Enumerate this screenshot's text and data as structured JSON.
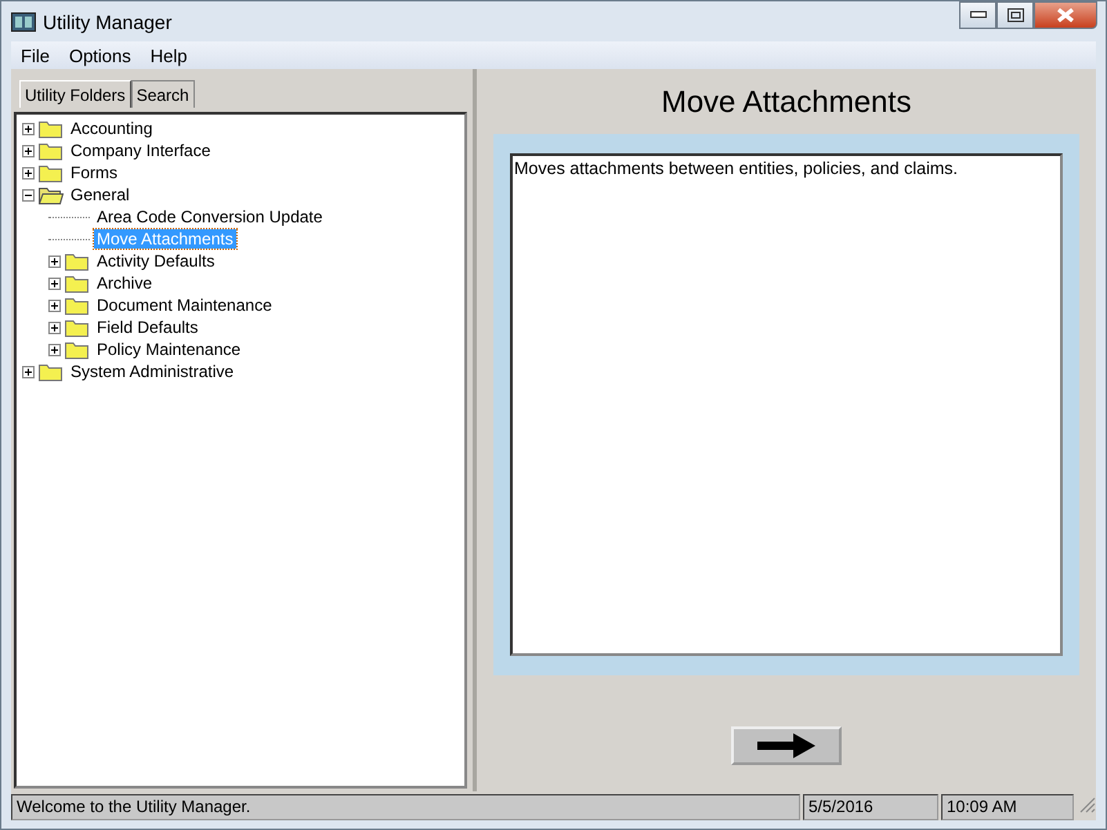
{
  "window": {
    "title": "Utility Manager"
  },
  "menu": [
    "File",
    "Options",
    "Help"
  ],
  "tabs": [
    {
      "label": "Utility Folders",
      "selected": true
    },
    {
      "label": "Search",
      "selected": false
    }
  ],
  "tree": [
    {
      "kind": "folder",
      "label": "Accounting",
      "expanded": false,
      "selected": false
    },
    {
      "kind": "folder",
      "label": "Company Interface",
      "expanded": false,
      "selected": false
    },
    {
      "kind": "folder",
      "label": "Forms",
      "expanded": false,
      "selected": false
    },
    {
      "kind": "folder",
      "label": "General",
      "expanded": true,
      "selected": false,
      "children": [
        {
          "kind": "leaf",
          "label": "Area Code Conversion Update",
          "selected": false
        },
        {
          "kind": "leaf",
          "label": "Move Attachments",
          "selected": true
        },
        {
          "kind": "folder",
          "label": "Activity Defaults",
          "expanded": false,
          "selected": false
        },
        {
          "kind": "folder",
          "label": "Archive",
          "expanded": false,
          "selected": false
        },
        {
          "kind": "folder",
          "label": "Document Maintenance",
          "expanded": false,
          "selected": false
        },
        {
          "kind": "folder",
          "label": "Field Defaults",
          "expanded": false,
          "selected": false
        },
        {
          "kind": "folder",
          "label": "Policy Maintenance",
          "expanded": false,
          "selected": false
        }
      ]
    },
    {
      "kind": "folder",
      "label": "System Administrative",
      "expanded": false,
      "selected": false
    }
  ],
  "detail": {
    "title": "Move Attachments",
    "description": "Moves attachments between entities, policies, and claims."
  },
  "status_bar": {
    "message": "Welcome to the Utility Manager.",
    "date": "5/5/2016",
    "time": "10:09 AM"
  }
}
